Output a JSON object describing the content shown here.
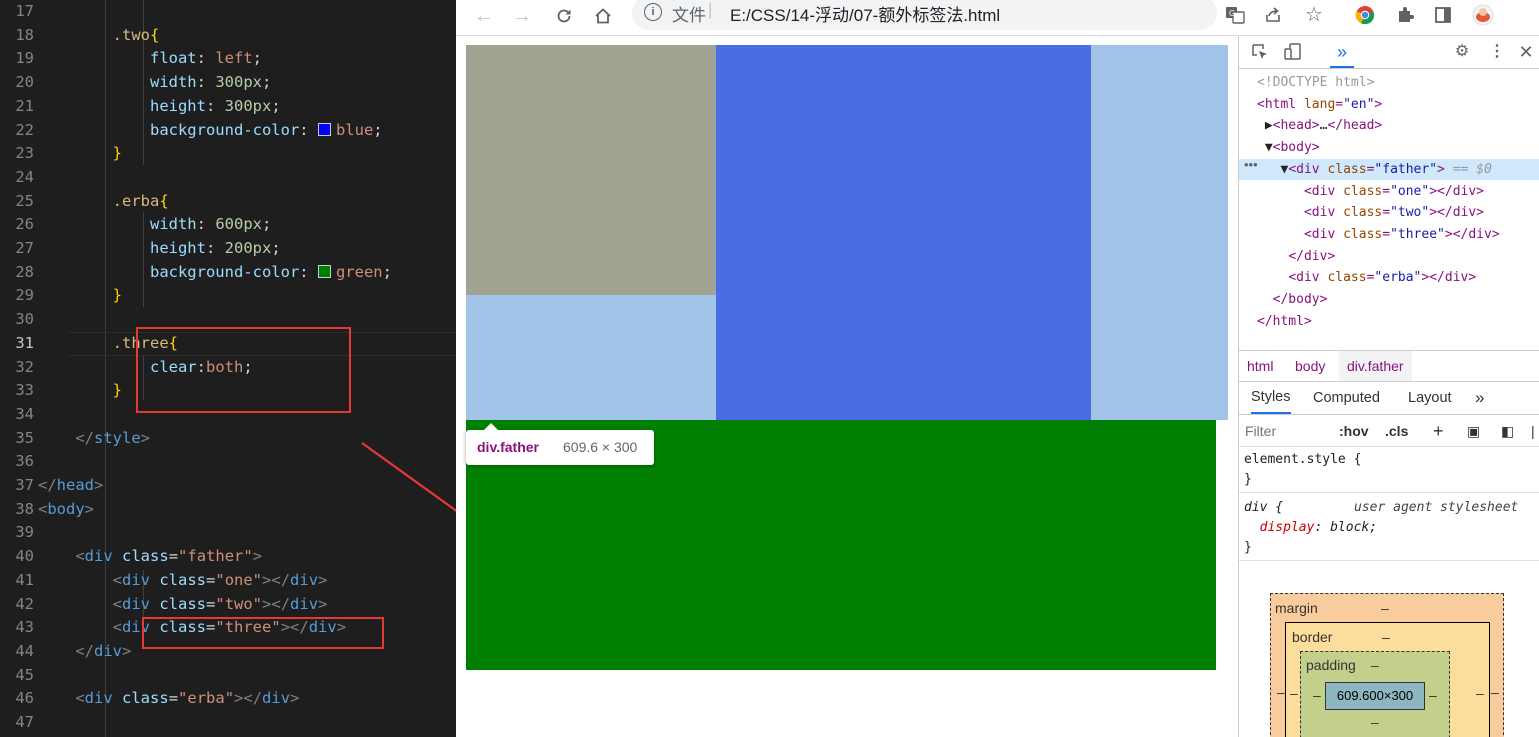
{
  "editor": {
    "lines": [
      {
        "n": "17",
        "html": ""
      },
      {
        "n": "18",
        "html": "        <span class='sel'>.two</span><span class='br'>{</span>"
      },
      {
        "n": "19",
        "html": "            <span class='prop'>float</span><span class='plain'>: </span><span class='val'>left</span><span class='plain'>;</span>"
      },
      {
        "n": "20",
        "html": "            <span class='prop'>width</span><span class='plain'>: </span><span class='num'>300px</span><span class='plain'>;</span>"
      },
      {
        "n": "21",
        "html": "            <span class='prop'>height</span><span class='plain'>: </span><span class='num'>300px</span><span class='plain'>;</span>"
      },
      {
        "n": "22",
        "html": "            <span class='prop'>background-color</span><span class='plain'>: </span><span class='swatch' style='background:#0000ff'></span><span class='val'>blue</span><span class='plain'>;</span>"
      },
      {
        "n": "23",
        "html": "        <span class='br'>}</span>"
      },
      {
        "n": "24",
        "html": ""
      },
      {
        "n": "25",
        "html": "        <span class='sel'>.erba</span><span class='br'>{</span>"
      },
      {
        "n": "26",
        "html": "            <span class='prop'>width</span><span class='plain'>: </span><span class='num'>600px</span><span class='plain'>;</span>"
      },
      {
        "n": "27",
        "html": "            <span class='prop'>height</span><span class='plain'>: </span><span class='num'>200px</span><span class='plain'>;</span>"
      },
      {
        "n": "28",
        "html": "            <span class='prop'>background-color</span><span class='plain'>: </span><span class='swatch' style='background:#008000'></span><span class='val'>green</span><span class='plain'>;</span>"
      },
      {
        "n": "29",
        "html": "        <span class='br'>}</span>"
      },
      {
        "n": "30",
        "html": ""
      },
      {
        "n": "31",
        "html": "        <span class='sel'>.three</span><span class='br'>{</span>"
      },
      {
        "n": "32",
        "html": "            <span class='prop'>clear</span><span class='plain'>:</span><span class='val'>both</span><span class='plain'>;</span>"
      },
      {
        "n": "33",
        "html": "        <span class='br'>}</span>"
      },
      {
        "n": "34",
        "html": ""
      },
      {
        "n": "35",
        "html": "    <span class='punc'>&lt;/</span><span class='tag'>style</span><span class='punc'>&gt;</span>"
      },
      {
        "n": "36",
        "html": ""
      },
      {
        "n": "37",
        "html": "<span class='punc'>&lt;/</span><span class='tag'>head</span><span class='punc'>&gt;</span>"
      },
      {
        "n": "38",
        "html": "<span class='punc'>&lt;</span><span class='tag'>body</span><span class='punc'>&gt;</span>"
      },
      {
        "n": "39",
        "html": ""
      },
      {
        "n": "40",
        "html": "    <span class='punc'>&lt;</span><span class='tag'>div</span> <span class='attr'>class</span><span class='plain'>=</span><span class='str'>\"father\"</span><span class='punc'>&gt;</span>"
      },
      {
        "n": "41",
        "html": "        <span class='punc'>&lt;</span><span class='tag'>div</span> <span class='attr'>class</span><span class='plain'>=</span><span class='str'>\"one\"</span><span class='punc'>&gt;&lt;/</span><span class='tag'>div</span><span class='punc'>&gt;</span>"
      },
      {
        "n": "42",
        "html": "        <span class='punc'>&lt;</span><span class='tag'>div</span> <span class='attr'>class</span><span class='plain'>=</span><span class='str'>\"two\"</span><span class='punc'>&gt;&lt;/</span><span class='tag'>div</span><span class='punc'>&gt;</span>"
      },
      {
        "n": "43",
        "html": "        <span class='punc'>&lt;</span><span class='tag'>div</span> <span class='attr'>class</span><span class='plain'>=</span><span class='str'>\"three\"</span><span class='punc'>&gt;&lt;/</span><span class='tag'>div</span><span class='punc'>&gt;</span>"
      },
      {
        "n": "44",
        "html": "    <span class='punc'>&lt;/</span><span class='tag'>div</span><span class='punc'>&gt;</span>"
      },
      {
        "n": "45",
        "html": ""
      },
      {
        "n": "46",
        "html": "    <span class='punc'>&lt;</span><span class='tag'>div</span> <span class='attr'>class</span><span class='plain'>=</span><span class='str'>\"erba\"</span><span class='punc'>&gt;&lt;/</span><span class='tag'>div</span><span class='punc'>&gt;</span>"
      },
      {
        "n": "47",
        "html": ""
      }
    ],
    "active_line": "31"
  },
  "browser": {
    "back_icon": "arrow-left-icon",
    "forward_icon": "arrow-right-icon",
    "reload_icon": "reload-icon",
    "home_icon": "home-icon",
    "scheme_label": "文件",
    "separator": "|",
    "url": "E:/CSS/14-浮动/07-额外标签法.html",
    "toolbar_icons": [
      "translate-icon",
      "share-icon",
      "star-icon",
      "chrome-icon",
      "extensions-icon",
      "sidepanel-icon",
      "avatar"
    ]
  },
  "page": {
    "colors": {
      "one": "#a0a391",
      "three": "#a1c4e8",
      "two": "#4a6de6",
      "erba": "#008000"
    },
    "tooltip": {
      "name": "div.father",
      "size": "609.6 × 300"
    }
  },
  "devtools": {
    "dom_lines": [
      {
        "html": "<span class='g'>&lt;!DOCTYPE html&gt;</span>"
      },
      {
        "html": "<span class='t'>&lt;html</span> <span class='a'>lang</span><span class='t'>=</span><span class='v'>\"en\"</span><span class='t'>&gt;</span>"
      },
      {
        "html": " <span class='dt'>▶</span><span class='t'>&lt;head&gt;</span><span class='dt'>…</span><span class='t'>&lt;/head&gt;</span>"
      },
      {
        "html": " <span class='dt'>▼</span><span class='t'>&lt;body&gt;</span>"
      },
      {
        "html": "   <span class='dt'>▼</span><span class='t'>&lt;div</span> <span class='a'>class</span><span class='t'>=</span><span class='v'>\"father\"</span><span class='t'>&gt;</span> <span class='g'>== </span><span class='g' style='font-style:italic'>$0</span>"
      },
      {
        "html": "      <span class='t'>&lt;div</span> <span class='a'>class</span><span class='t'>=</span><span class='v'>\"one\"</span><span class='t'>&gt;&lt;/div&gt;</span>"
      },
      {
        "html": "      <span class='t'>&lt;div</span> <span class='a'>class</span><span class='t'>=</span><span class='v'>\"two\"</span><span class='t'>&gt;&lt;/div&gt;</span>"
      },
      {
        "html": "      <span class='t'>&lt;div</span> <span class='a'>class</span><span class='t'>=</span><span class='v'>\"three\"</span><span class='t'>&gt;&lt;/div&gt;</span>"
      },
      {
        "html": "    <span class='t'>&lt;/div&gt;</span>"
      },
      {
        "html": "    <span class='t'>&lt;div</span> <span class='a'>class</span><span class='t'>=</span><span class='v'>\"erba\"</span><span class='t'>&gt;&lt;/div&gt;</span>"
      },
      {
        "html": "  <span class='t'>&lt;/body&gt;</span>"
      },
      {
        "html": "<span class='t'>&lt;/html&gt;</span>"
      }
    ],
    "crumbs": [
      "html",
      "body",
      "div.father"
    ],
    "tabs": [
      "Styles",
      "Computed",
      "Layout",
      "»"
    ],
    "filter_placeholder": "Filter",
    "hov": ":hov",
    "cls": ".cls",
    "rules": {
      "element_style_open": "element.style {",
      "close": "}",
      "div_selector": "div {",
      "ua_label": "user agent stylesheet",
      "display_prop": "display",
      "display_val": "block;"
    },
    "boxmodel": {
      "margin": "margin",
      "border": "border",
      "padding": "padding",
      "content": "609.600×300",
      "dash": "–"
    }
  }
}
